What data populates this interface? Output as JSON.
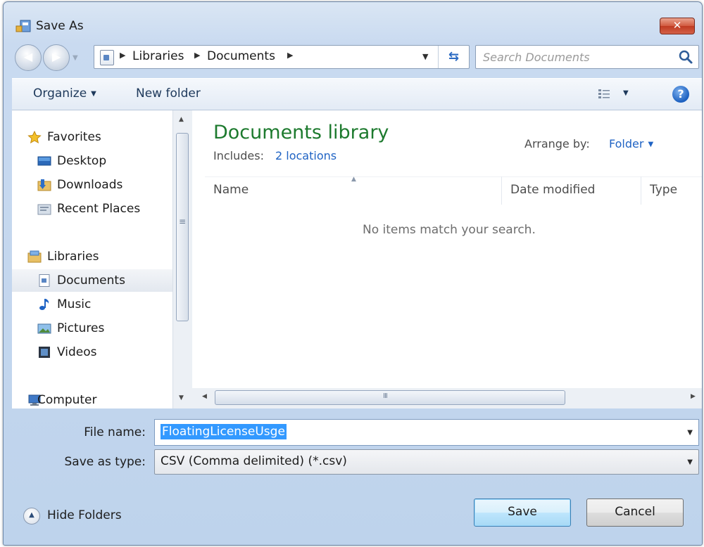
{
  "window": {
    "title": "Save As",
    "close_label": "✕"
  },
  "nav": {
    "back_icon": "back-arrow-icon",
    "forward_icon": "forward-arrow-icon",
    "breadcrumb": [
      "Libraries",
      "Documents"
    ],
    "search_placeholder": "Search Documents"
  },
  "toolbar": {
    "organize": "Organize",
    "new_folder": "New folder",
    "help_label": "?"
  },
  "sidebar": {
    "items": [
      {
        "label": "Favorites",
        "icon": "star-icon"
      },
      {
        "label": "Desktop",
        "icon": "desktop-icon"
      },
      {
        "label": "Downloads",
        "icon": "downloads-icon"
      },
      {
        "label": "Recent Places",
        "icon": "recent-places-icon"
      },
      {
        "label": "Libraries",
        "icon": "libraries-icon"
      },
      {
        "label": "Documents",
        "icon": "documents-icon",
        "selected": true
      },
      {
        "label": "Music",
        "icon": "music-icon"
      },
      {
        "label": "Pictures",
        "icon": "pictures-icon"
      },
      {
        "label": "Videos",
        "icon": "videos-icon"
      },
      {
        "label": "Computer",
        "icon": "computer-icon"
      }
    ]
  },
  "content": {
    "title": "Documents library",
    "includes_label": "Includes:",
    "includes_link": "2 locations",
    "arrange_label": "Arrange by:",
    "arrange_value": "Folder",
    "columns": [
      "Name",
      "Date modified",
      "Type"
    ],
    "empty_message": "No items match your search."
  },
  "form": {
    "file_name_label": "File name:",
    "file_name_value": "FloatingLicenseUsge",
    "save_type_label": "Save as type:",
    "save_type_value": "CSV (Comma delimited) (*.csv)"
  },
  "footer": {
    "hide_folders": "Hide Folders",
    "save": "Save",
    "cancel": "Cancel"
  },
  "colors": {
    "library_title": "#1d7a2e",
    "link": "#1f63c4",
    "selection": "#3399ff",
    "close_button": "#c8472d"
  }
}
